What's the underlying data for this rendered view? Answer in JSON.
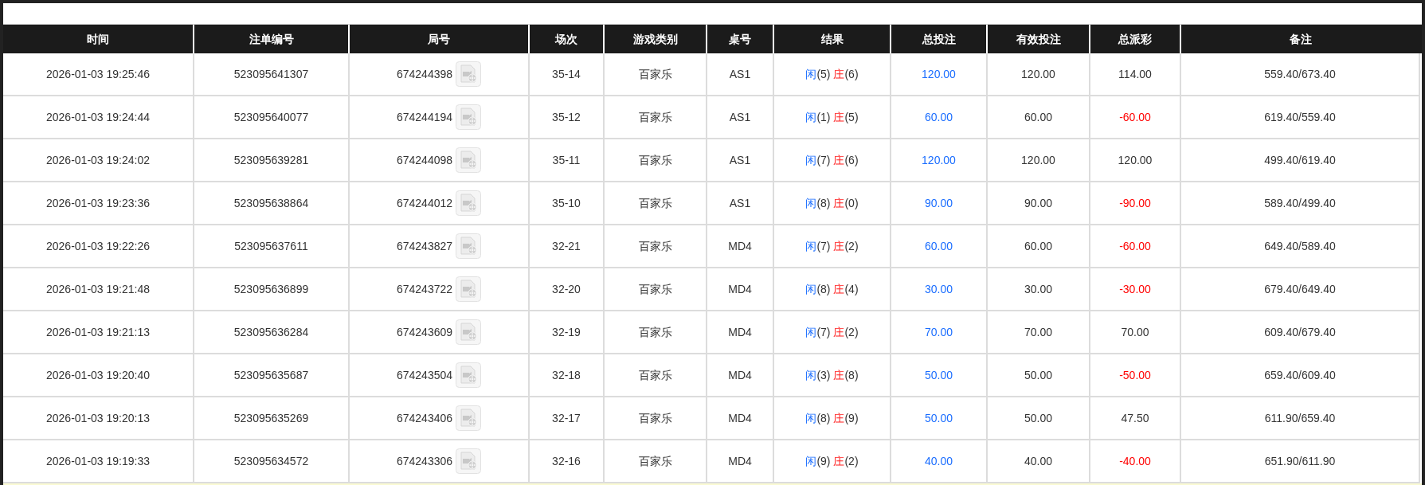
{
  "table": {
    "columns": [
      "时间",
      "注单编号",
      "局号",
      "场次",
      "游戏类别",
      "桌号",
      "结果",
      "总投注",
      "有效投注",
      "总派彩",
      "备注"
    ],
    "rows": [
      {
        "time": "2026-01-03 19:25:46",
        "bet_id": "523095641307",
        "round": "674244398",
        "shoe": "35-14",
        "game": "百家乐",
        "table": "AS1",
        "result": {
          "player_label": "闲",
          "player": "(5)",
          "banker_label": "庄",
          "banker": "(6)"
        },
        "total_bet": "120.00",
        "valid_bet": "120.00",
        "payout": "114.00",
        "loss": false,
        "note": "559.40/673.40"
      },
      {
        "time": "2026-01-03 19:24:44",
        "bet_id": "523095640077",
        "round": "674244194",
        "shoe": "35-12",
        "game": "百家乐",
        "table": "AS1",
        "result": {
          "player_label": "闲",
          "player": "(1)",
          "banker_label": "庄",
          "banker": "(5)"
        },
        "total_bet": "60.00",
        "valid_bet": "60.00",
        "payout": "-60.00",
        "loss": true,
        "note": "619.40/559.40"
      },
      {
        "time": "2026-01-03 19:24:02",
        "bet_id": "523095639281",
        "round": "674244098",
        "shoe": "35-11",
        "game": "百家乐",
        "table": "AS1",
        "result": {
          "player_label": "闲",
          "player": "(7)",
          "banker_label": "庄",
          "banker": "(6)"
        },
        "total_bet": "120.00",
        "valid_bet": "120.00",
        "payout": "120.00",
        "loss": false,
        "note": "499.40/619.40"
      },
      {
        "time": "2026-01-03 19:23:36",
        "bet_id": "523095638864",
        "round": "674244012",
        "shoe": "35-10",
        "game": "百家乐",
        "table": "AS1",
        "result": {
          "player_label": "闲",
          "player": "(8)",
          "banker_label": "庄",
          "banker": "(0)"
        },
        "total_bet": "90.00",
        "valid_bet": "90.00",
        "payout": "-90.00",
        "loss": true,
        "note": "589.40/499.40"
      },
      {
        "time": "2026-01-03 19:22:26",
        "bet_id": "523095637611",
        "round": "674243827",
        "shoe": "32-21",
        "game": "百家乐",
        "table": "MD4",
        "result": {
          "player_label": "闲",
          "player": "(7)",
          "banker_label": "庄",
          "banker": "(2)"
        },
        "total_bet": "60.00",
        "valid_bet": "60.00",
        "payout": "-60.00",
        "loss": true,
        "note": "649.40/589.40"
      },
      {
        "time": "2026-01-03 19:21:48",
        "bet_id": "523095636899",
        "round": "674243722",
        "shoe": "32-20",
        "game": "百家乐",
        "table": "MD4",
        "result": {
          "player_label": "闲",
          "player": "(8)",
          "banker_label": "庄",
          "banker": "(4)"
        },
        "total_bet": "30.00",
        "valid_bet": "30.00",
        "payout": "-30.00",
        "loss": true,
        "note": "679.40/649.40"
      },
      {
        "time": "2026-01-03 19:21:13",
        "bet_id": "523095636284",
        "round": "674243609",
        "shoe": "32-19",
        "game": "百家乐",
        "table": "MD4",
        "result": {
          "player_label": "闲",
          "player": "(7)",
          "banker_label": "庄",
          "banker": "(2)"
        },
        "total_bet": "70.00",
        "valid_bet": "70.00",
        "payout": "70.00",
        "loss": false,
        "note": "609.40/679.40"
      },
      {
        "time": "2026-01-03 19:20:40",
        "bet_id": "523095635687",
        "round": "674243504",
        "shoe": "32-18",
        "game": "百家乐",
        "table": "MD4",
        "result": {
          "player_label": "闲",
          "player": "(3)",
          "banker_label": "庄",
          "banker": "(8)"
        },
        "total_bet": "50.00",
        "valid_bet": "50.00",
        "payout": "-50.00",
        "loss": true,
        "note": "659.40/609.40"
      },
      {
        "time": "2026-01-03 19:20:13",
        "bet_id": "523095635269",
        "round": "674243406",
        "shoe": "32-17",
        "game": "百家乐",
        "table": "MD4",
        "result": {
          "player_label": "闲",
          "player": "(8)",
          "banker_label": "庄",
          "banker": "(9)"
        },
        "total_bet": "50.00",
        "valid_bet": "50.00",
        "payout": "47.50",
        "loss": false,
        "note": "611.90/659.40"
      },
      {
        "time": "2026-01-03 19:19:33",
        "bet_id": "523095634572",
        "round": "674243306",
        "shoe": "32-16",
        "game": "百家乐",
        "table": "MD4",
        "result": {
          "player_label": "闲",
          "player": "(9)",
          "banker_label": "庄",
          "banker": "(2)"
        },
        "total_bet": "40.00",
        "valid_bet": "40.00",
        "payout": "-40.00",
        "loss": true,
        "note": "651.90/611.90"
      }
    ]
  }
}
